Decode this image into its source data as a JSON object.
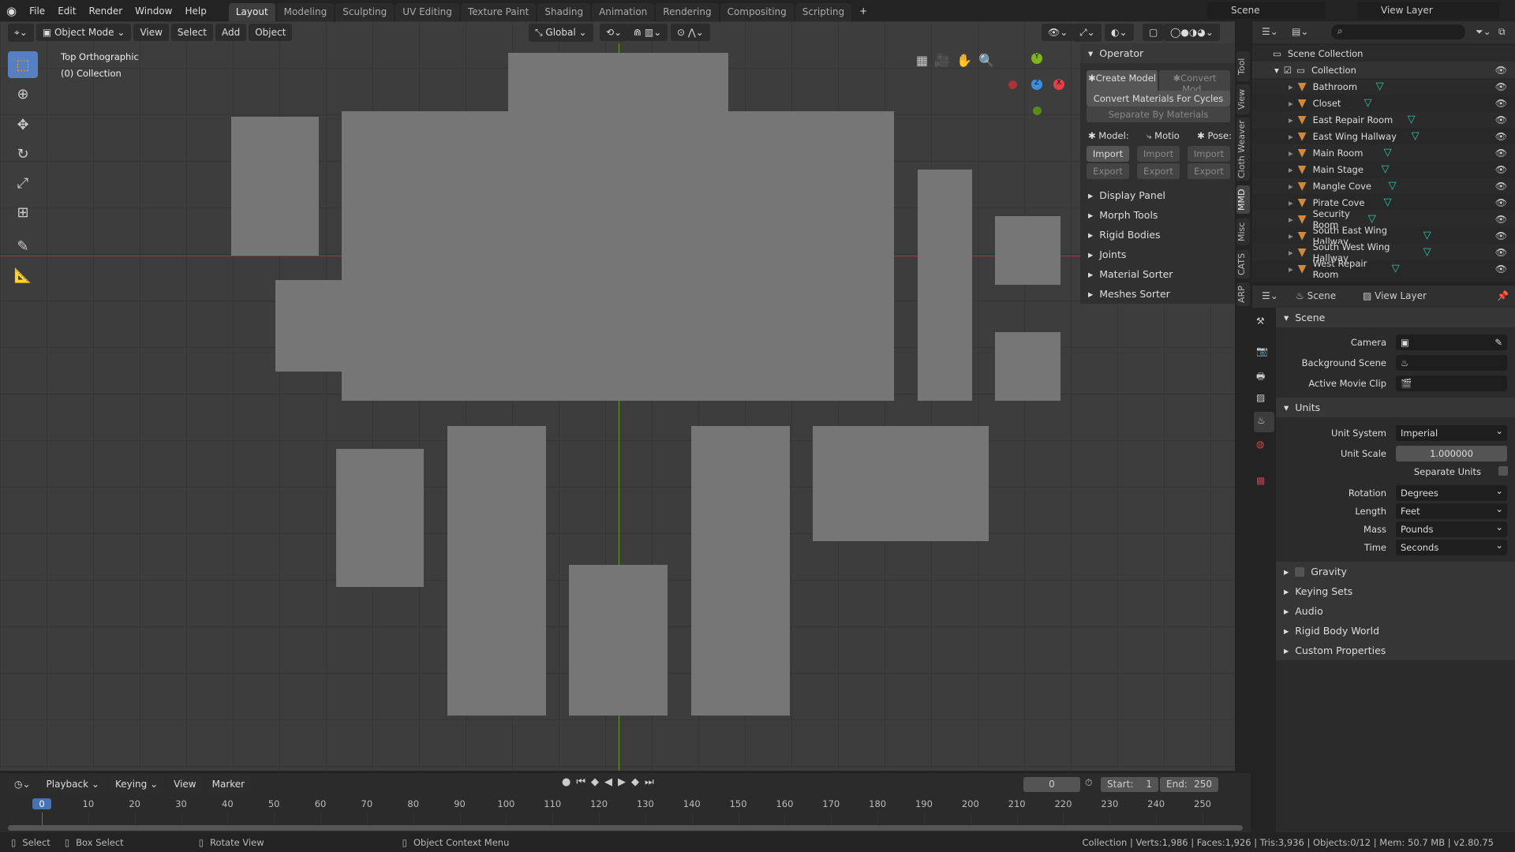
{
  "topbar": {
    "menus": [
      "File",
      "Edit",
      "Render",
      "Window",
      "Help"
    ],
    "workspaces": [
      "Layout",
      "Modeling",
      "Sculpting",
      "UV Editing",
      "Texture Paint",
      "Shading",
      "Animation",
      "Rendering",
      "Compositing",
      "Scripting"
    ],
    "active_workspace": "Layout",
    "add_tab": "+",
    "scene": "Scene",
    "view_layer": "View Layer"
  },
  "viewport": {
    "mode": "Object Mode",
    "menus": [
      "View",
      "Select",
      "Add",
      "Object"
    ],
    "orientation": "Global",
    "view_name": "Top Orthographic",
    "collection_label": "(0) Collection",
    "gizmo": {
      "y": "Y",
      "z": "Z",
      "x": "X"
    },
    "axis_colors": {
      "x": "#9b3a3a",
      "y": "#6a9b2a"
    }
  },
  "npanel": {
    "operator": "Operator",
    "create_model": "Create Model",
    "convert_model": "Convert Mod..",
    "convert_materials": "Convert Materials For Cycles",
    "separate_materials": "Separate By Materials",
    "model": "Model:",
    "motion": "Motio",
    "pose": "Pose:",
    "import": "Import",
    "export": "Export",
    "sections": [
      "Display Panel",
      "Morph Tools",
      "Rigid Bodies",
      "Joints",
      "Material Sorter",
      "Meshes Sorter"
    ],
    "tabs": [
      "Tool",
      "View",
      "Cloth Weaver",
      "MMD",
      "Misc",
      "CATS",
      "ARP"
    ]
  },
  "outliner": {
    "root": "Scene Collection",
    "collection": "Collection",
    "items": [
      "Bathroom",
      "Closet",
      "East Repair Room",
      "East Wing Hallway",
      "Main Room",
      "Main Stage",
      "Mangle Cove",
      "Pirate Cove",
      "Security Room",
      "South East Wing Hallway",
      "South West Wing Hallway",
      "West Repair Room"
    ]
  },
  "properties": {
    "breadcrumb_scene": "Scene",
    "breadcrumb_layer": "View Layer",
    "scene_section": "Scene",
    "camera": "Camera",
    "background_scene": "Background Scene",
    "active_movie_clip": "Active Movie Clip",
    "units_section": "Units",
    "unit_system_label": "Unit System",
    "unit_system": "Imperial",
    "unit_scale_label": "Unit Scale",
    "unit_scale": "1.000000",
    "separate_units": "Separate Units",
    "rotation_label": "Rotation",
    "rotation": "Degrees",
    "length_label": "Length",
    "length": "Feet",
    "mass_label": "Mass",
    "mass": "Pounds",
    "time_label": "Time",
    "time": "Seconds",
    "collapsed": [
      "Gravity",
      "Keying Sets",
      "Audio",
      "Rigid Body World",
      "Custom Properties"
    ]
  },
  "timeline": {
    "menus": [
      "Playback",
      "Keying",
      "View",
      "Marker"
    ],
    "current_frame": "0",
    "start_label": "Start:",
    "start": "1",
    "end_label": "End:",
    "end": "250",
    "ticks": [
      "0",
      "10",
      "20",
      "30",
      "40",
      "50",
      "60",
      "70",
      "80",
      "90",
      "100",
      "110",
      "120",
      "130",
      "140",
      "150",
      "160",
      "170",
      "180",
      "190",
      "200",
      "210",
      "220",
      "230",
      "240",
      "250"
    ]
  },
  "statusbar": {
    "select": "Select",
    "box_select": "Box Select",
    "rotate_view": "Rotate View",
    "context_menu": "Object Context Menu",
    "stats": "Collection | Verts:1,986 | Faces:1,926 | Tris:3,936 | Objects:0/12 | Mem: 50.7 MB | v2.80.75"
  }
}
